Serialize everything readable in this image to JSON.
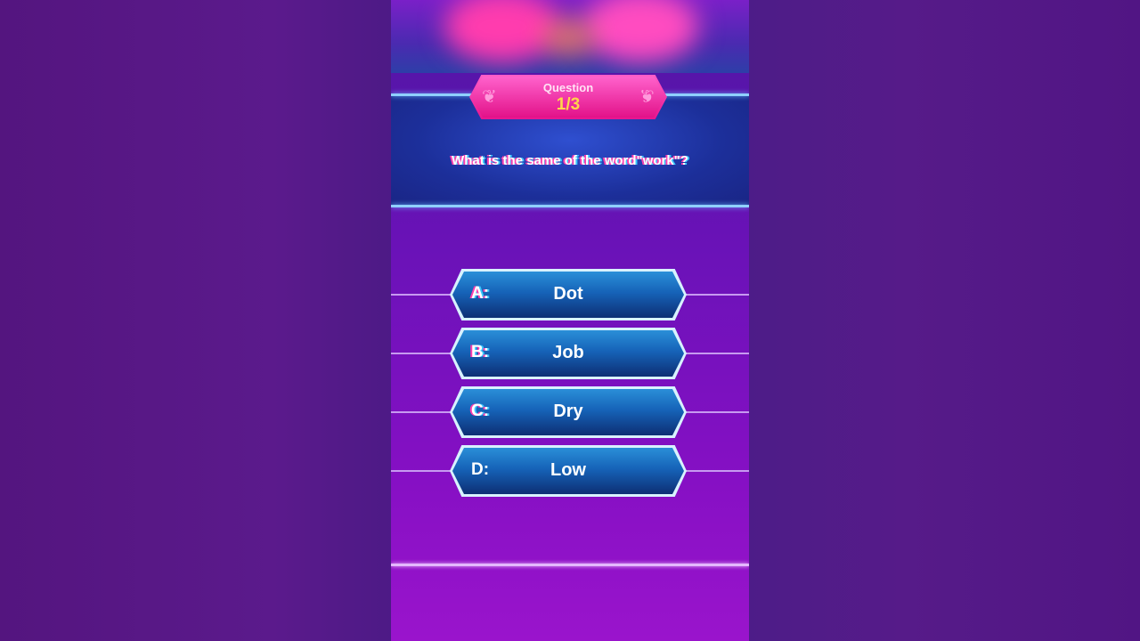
{
  "question": {
    "badge_label": "Question",
    "counter": "1/3",
    "text": "What is the same of the word\"work\"?"
  },
  "answers": [
    {
      "letter": "A:",
      "text": "Dot"
    },
    {
      "letter": "B:",
      "text": "Job"
    },
    {
      "letter": "C:",
      "text": "Dry"
    },
    {
      "letter": "D:",
      "text": "Low"
    }
  ],
  "colors": {
    "background": "#521a86",
    "badge": "#e8148f",
    "counter": "#ffd54a",
    "answer_fill": "#1663b8",
    "glow_line": "#8fd0ff"
  }
}
